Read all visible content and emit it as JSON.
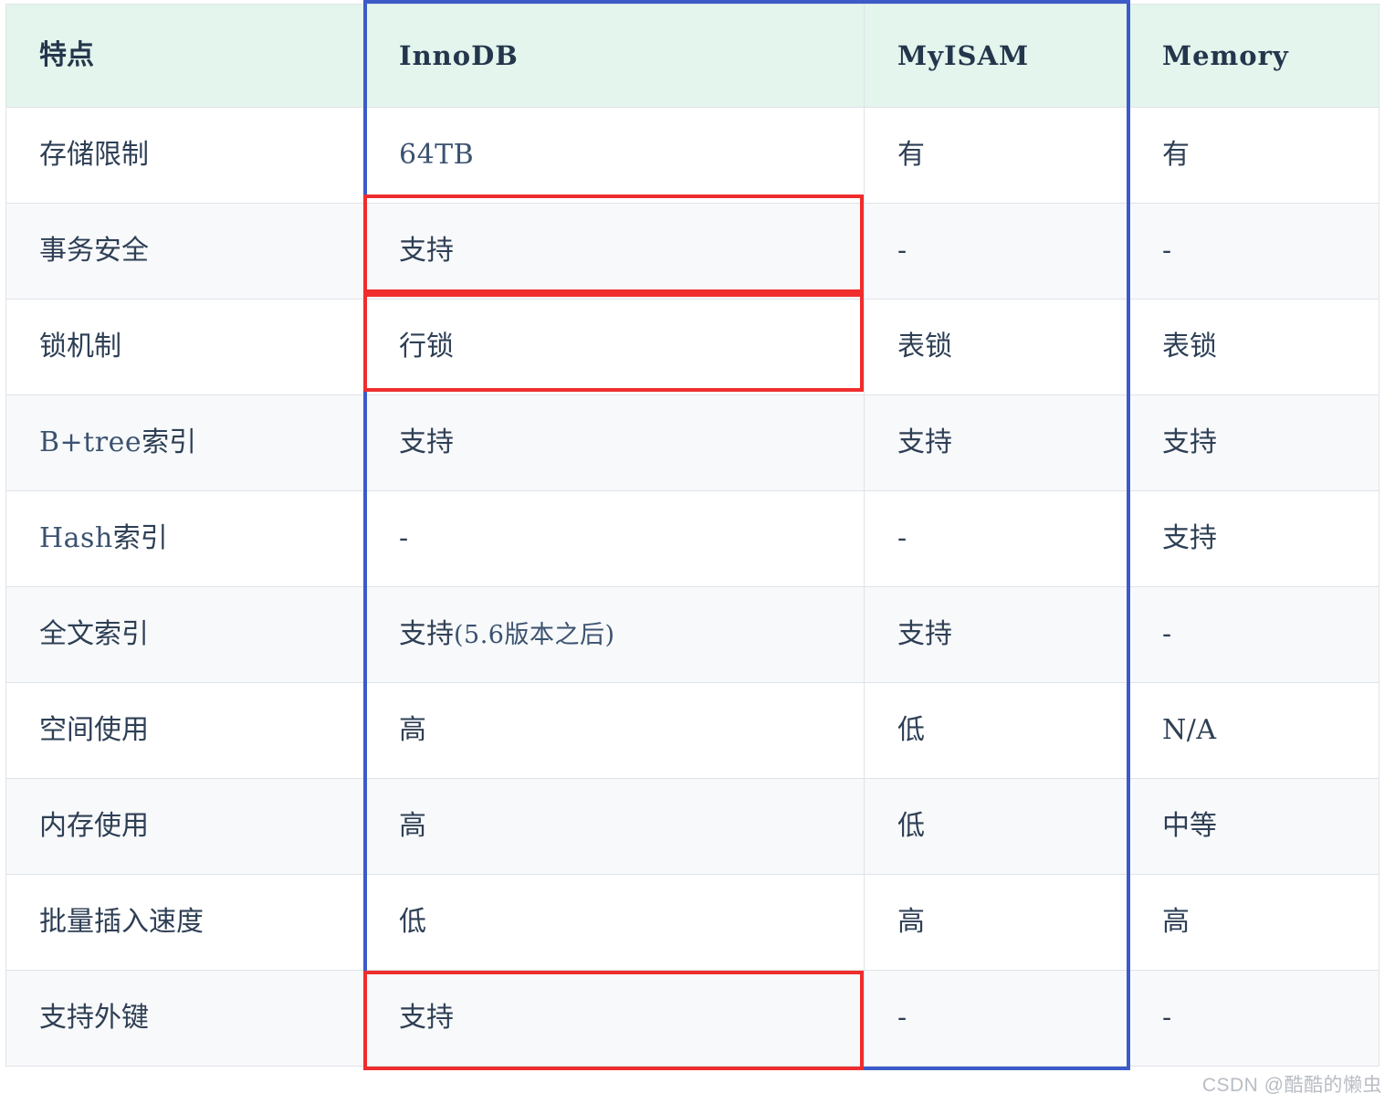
{
  "table": {
    "columns": [
      {
        "key": "feature",
        "label": "特点",
        "style": "cjk"
      },
      {
        "key": "innodb",
        "label": "InnoDB",
        "style": "mono"
      },
      {
        "key": "myisam",
        "label": "MyISAM",
        "style": "mono"
      },
      {
        "key": "memory",
        "label": "Memory",
        "style": "mono"
      }
    ],
    "rows": [
      {
        "feature": "存储限制",
        "feature_mono": "",
        "innodb": "64TB",
        "innodb_note": "",
        "myisam": "有",
        "memory": "有"
      },
      {
        "feature": "事务安全",
        "feature_mono": "",
        "innodb": "支持",
        "innodb_note": "",
        "myisam": "-",
        "memory": "-"
      },
      {
        "feature": "锁机制",
        "feature_mono": "",
        "innodb": "行锁",
        "innodb_note": "",
        "myisam": "表锁",
        "memory": "表锁"
      },
      {
        "feature": "索引",
        "feature_mono": "B+tree",
        "innodb": "支持",
        "innodb_note": "",
        "myisam": "支持",
        "memory": "支持"
      },
      {
        "feature": "索引",
        "feature_mono": "Hash",
        "innodb": "-",
        "innodb_note": "",
        "myisam": "-",
        "memory": "支持"
      },
      {
        "feature": "全文索引",
        "feature_mono": "",
        "innodb": "支持",
        "innodb_note": "(5.6版本之后)",
        "myisam": "支持",
        "memory": "-"
      },
      {
        "feature": "空间使用",
        "feature_mono": "",
        "innodb": "高",
        "innodb_note": "",
        "myisam": "低",
        "memory": "N/A"
      },
      {
        "feature": "内存使用",
        "feature_mono": "",
        "innodb": "高",
        "innodb_note": "",
        "myisam": "低",
        "memory": "中等"
      },
      {
        "feature": "批量插入速度",
        "feature_mono": "",
        "innodb": "低",
        "innodb_note": "",
        "myisam": "高",
        "memory": "高"
      },
      {
        "feature": "支持外键",
        "feature_mono": "",
        "innodb": "支持",
        "innodb_note": "",
        "myisam": "-",
        "memory": "-"
      }
    ]
  },
  "annotations": {
    "blue_box": {
      "label": "innodb-column-highlight",
      "color": "#3c5bc8"
    },
    "red_boxes": [
      {
        "label": "transaction-safety-innodb-highlight",
        "color": "#ef2d2d"
      },
      {
        "label": "lock-mechanism-innodb-highlight",
        "color": "#ef2d2d"
      },
      {
        "label": "foreign-key-innodb-highlight",
        "color": "#ef2d2d"
      }
    ]
  },
  "watermark": {
    "text": "CSDN @酷酷的懒虫"
  },
  "palette": {
    "header_bg": "#e3f5ec",
    "row_alt_bg": "#f8f9fa",
    "row_bg": "#ffffff",
    "grid": "#dfe3e8",
    "text": "#2e3f55",
    "mono_text": "#3b5270",
    "highlight_blue": "#3c5bc8",
    "highlight_red": "#ef2d2d",
    "watermark": "#b9bdc4"
  }
}
